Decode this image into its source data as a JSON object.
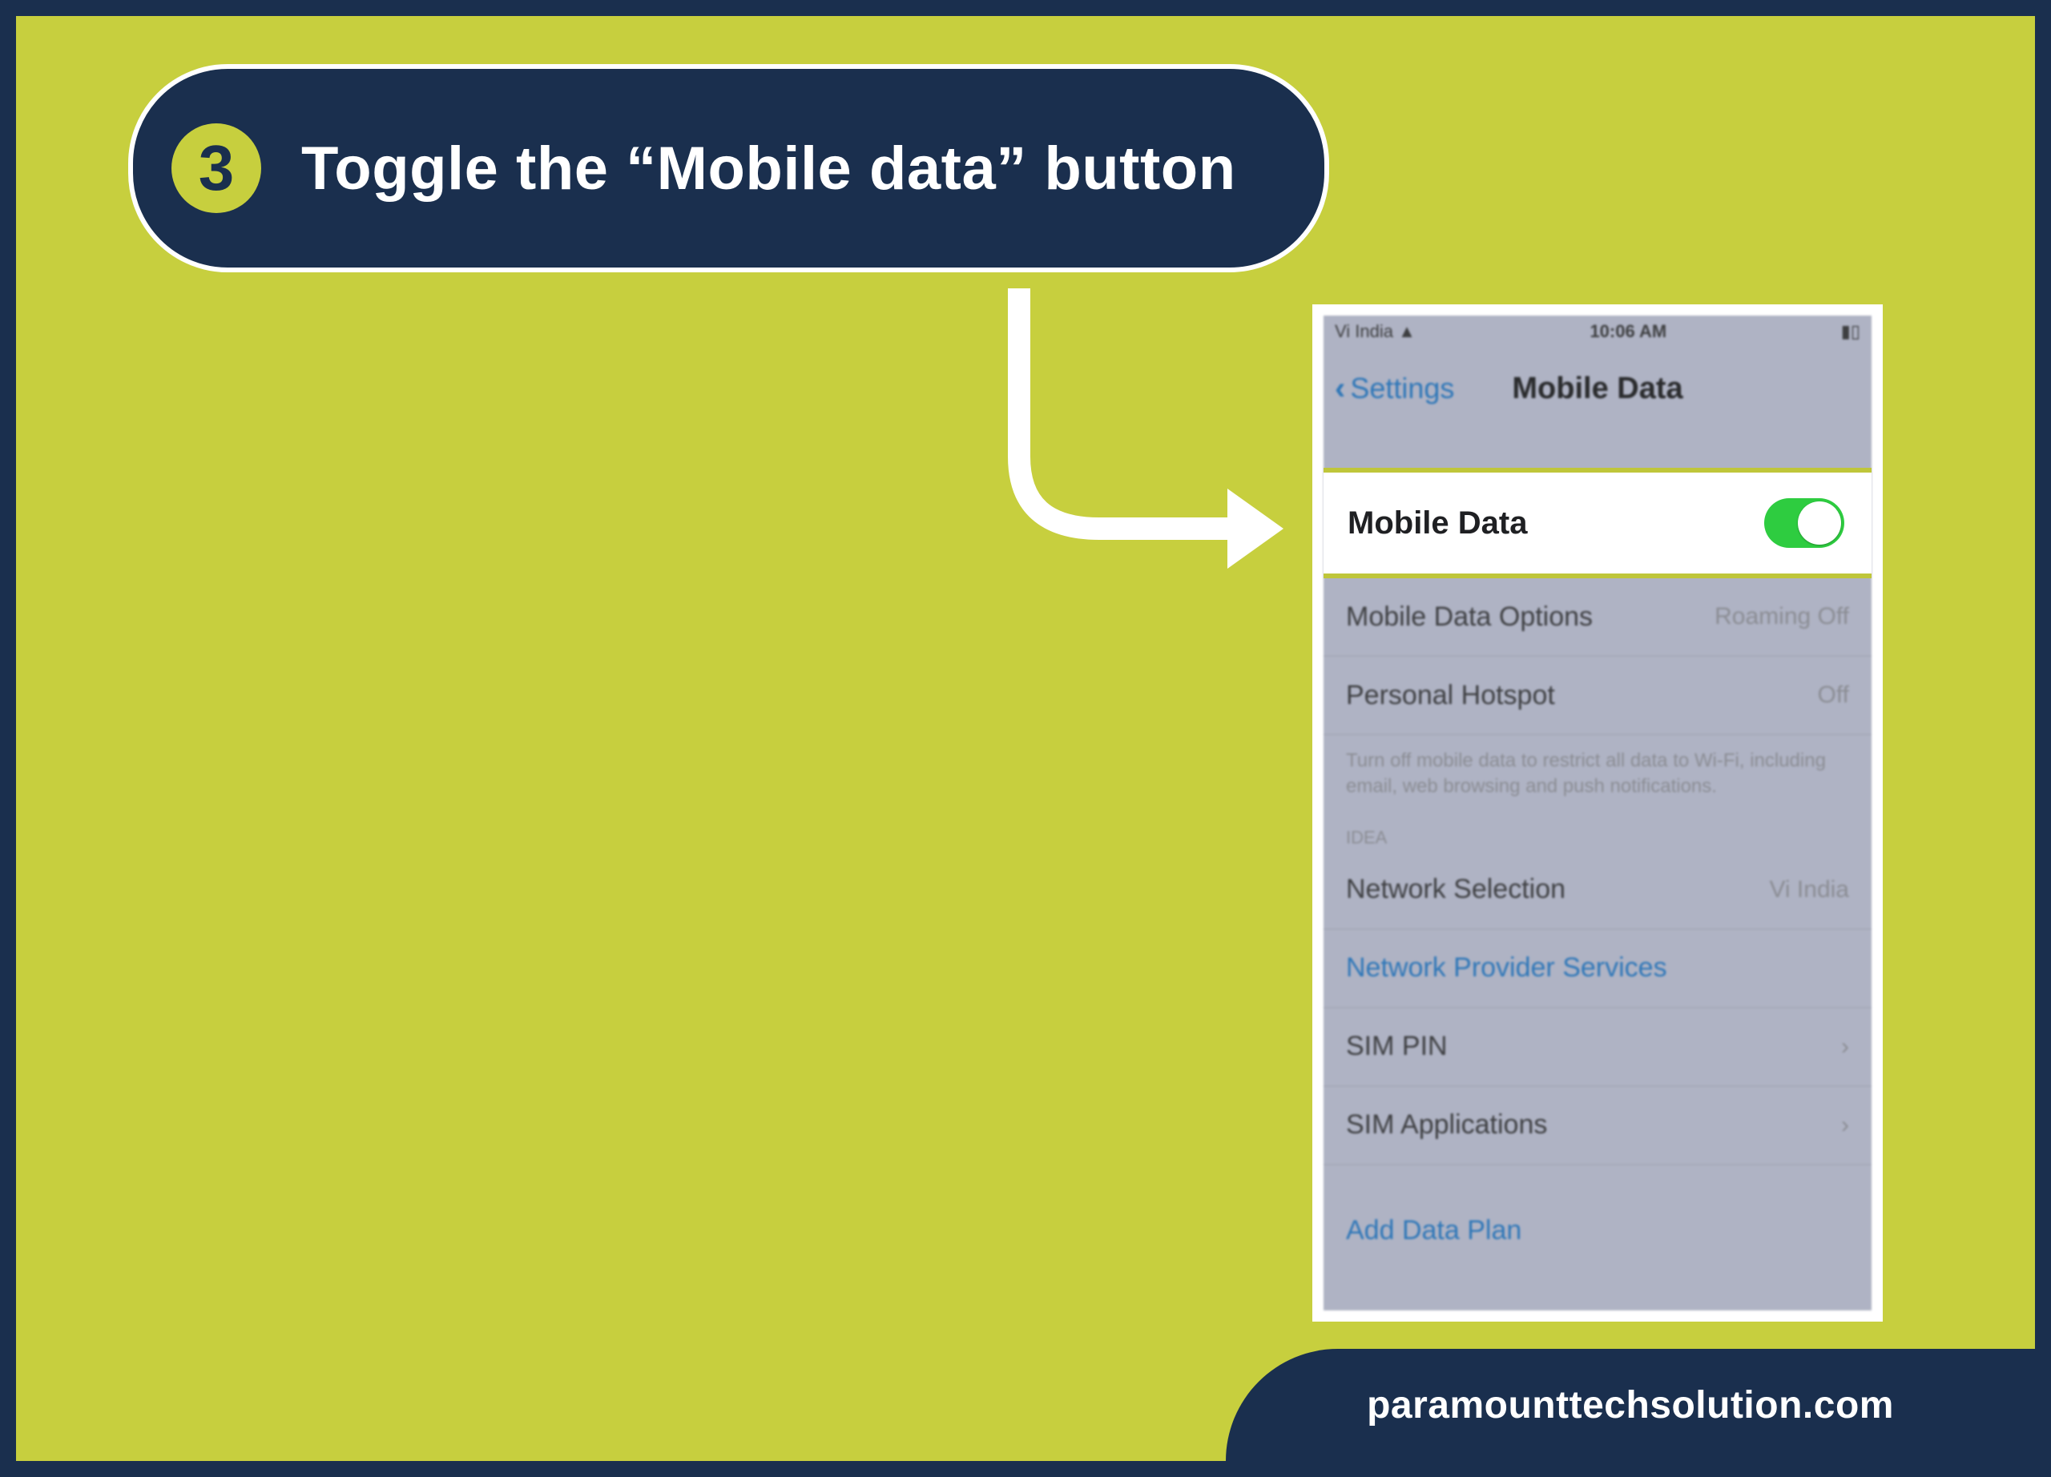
{
  "step": {
    "number": "3",
    "title": "Toggle the “Mobile data” button"
  },
  "phone": {
    "status": {
      "carrier": "Vi India",
      "time": "10:06 AM"
    },
    "nav": {
      "back": "Settings",
      "title": "Mobile Data"
    },
    "highlight": {
      "label": "Mobile Data",
      "toggle_on": true
    },
    "rows": {
      "options": {
        "label": "Mobile Data Options",
        "value": "Roaming Off"
      },
      "hotspot": {
        "label": "Personal Hotspot",
        "value": "Off"
      },
      "note": "Turn off mobile data to restrict all data to Wi-Fi, including email, web browsing and push notifications.",
      "carrier_section": "IDEA",
      "network_selection": {
        "label": "Network Selection",
        "value": "Vi India"
      },
      "provider_services": "Network Provider Services",
      "sim_pin": "SIM PIN",
      "sim_apps": "SIM Applications",
      "add_plan": "Add Data Plan"
    }
  },
  "footer": {
    "brand": "paramounttechsolution.com"
  }
}
